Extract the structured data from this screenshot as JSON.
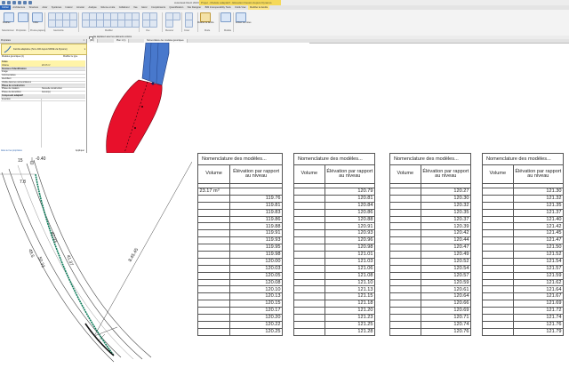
{
  "app": {
    "title": "Autodesk Revit 2023.1",
    "context_tab_title": "Projet - Modèle adaptatif - Elévation Dessin depuis Dynamo"
  },
  "ribbon": {
    "tabs": [
      "Fichier",
      "Architecture",
      "Structure",
      "Acier",
      "Systèmes",
      "Insérer",
      "Annoter",
      "Analyse",
      "Volume et site",
      "Collaborer",
      "Vue",
      "Gérer",
      "Compléments",
      "Quantification",
      "Site Designer",
      "BIM Interoperability Tools",
      "Outils Vrac"
    ],
    "groups": [
      "Sélectionner",
      "Propriétés",
      "Presse-papiers",
      "Géométrie",
      "Modifier",
      "Vue",
      "Mesurer",
      "Créer",
      "Mode",
      "Modèle"
    ],
    "buttons": {
      "modify": "Modifier",
      "paste": "Coller",
      "modify_family": "Modifier la famille",
      "edit_mode": "Activer les cotes",
      "host": "Choisir un nouvel hôte"
    }
  },
  "options_bar": {
    "label": "Ne déplacez avec les éléments voisins"
  },
  "properties": {
    "header": "Propriétés",
    "type_name": "Famille adaptative (Terre 400 depuis MODE via Dynamo)",
    "type_selector": "Modèles génériques (1)",
    "edit_type": "Modifier le type",
    "rows": [
      {
        "k": "Cotes",
        "v": "",
        "sect": true,
        "hl": true
      },
      {
        "k": "Volume",
        "v": "23.17 m³",
        "hl": true
      },
      {
        "k": "Données d'identification",
        "v": "",
        "sect": true
      },
      {
        "k": "Image",
        "v": ""
      },
      {
        "k": "Commentaires",
        "v": ""
      },
      {
        "k": "Identifiant",
        "v": ""
      },
      {
        "k": "Visible dans les nomenclatures",
        "v": ""
      },
      {
        "k": "Phase de construction",
        "v": "",
        "sect": true
      },
      {
        "k": "Phase de création",
        "v": "Nouvelle construction"
      },
      {
        "k": "Phase de démolition",
        "v": "Aucun(e)"
      },
      {
        "k": "Composant adaptatif",
        "v": "",
        "sect": true
      },
      {
        "k": "Inversion",
        "v": ""
      }
    ],
    "help_link": "Aide sur les propriétés",
    "apply": "Appliquer"
  },
  "view_tabs": [
    "{3D}",
    "Plan 1 (1)",
    "Nomenclature des modèles génériques"
  ],
  "plan": {
    "annotations": [
      "-0.40",
      "8.45.45",
      "41.37",
      "42.03",
      "50.33",
      "49.5",
      "7.8",
      "15"
    ]
  },
  "schedules": [
    {
      "title": "Nomenclature des modèles...",
      "col1": "Volume",
      "col2": "Élévation par rapport au niveau",
      "rows": [
        [
          "23.17 m³",
          ""
        ],
        [
          "",
          "119.76"
        ],
        [
          "",
          "119.81"
        ],
        [
          "",
          "119.83"
        ],
        [
          "",
          "119.86"
        ],
        [
          "",
          "119.88"
        ],
        [
          "",
          "119.91"
        ],
        [
          "",
          "119.93"
        ],
        [
          "",
          "119.95"
        ],
        [
          "",
          "119.98"
        ],
        [
          "",
          "120.00"
        ],
        [
          "",
          "120.03"
        ],
        [
          "",
          "120.05"
        ],
        [
          "",
          "120.08"
        ],
        [
          "",
          "120.10"
        ],
        [
          "",
          "120.13"
        ],
        [
          "",
          "120.15"
        ],
        [
          "",
          "120.17"
        ],
        [
          "",
          "120.20"
        ],
        [
          "",
          "120.22"
        ],
        [
          "",
          "120.25"
        ]
      ]
    },
    {
      "title": "Nomenclature des modèles...",
      "col1": "Volume",
      "col2": "Élévation par rapport au niveau",
      "rows": [
        [
          "",
          "120.79"
        ],
        [
          "",
          "120.81"
        ],
        [
          "",
          "120.84"
        ],
        [
          "",
          "120.86"
        ],
        [
          "",
          "120.88"
        ],
        [
          "",
          "120.91"
        ],
        [
          "",
          "120.93"
        ],
        [
          "",
          "120.96"
        ],
        [
          "",
          "120.98"
        ],
        [
          "",
          "121.01"
        ],
        [
          "",
          "121.03"
        ],
        [
          "",
          "121.06"
        ],
        [
          "",
          "121.08"
        ],
        [
          "",
          "121.10"
        ],
        [
          "",
          "121.13"
        ],
        [
          "",
          "121.15"
        ],
        [
          "",
          "121.18"
        ],
        [
          "",
          "121.20"
        ],
        [
          "",
          "121.23"
        ],
        [
          "",
          "121.25"
        ],
        [
          "",
          "121.28"
        ]
      ]
    },
    {
      "title": "Nomenclature des modèles...",
      "col1": "Volume",
      "col2": "Élévation par rapport au niveau",
      "rows": [
        [
          "",
          "120.27"
        ],
        [
          "",
          "120.30"
        ],
        [
          "",
          "120.32"
        ],
        [
          "",
          "120.35"
        ],
        [
          "",
          "120.37"
        ],
        [
          "",
          "120.39"
        ],
        [
          "",
          "120.42"
        ],
        [
          "",
          "120.44"
        ],
        [
          "",
          "120.47"
        ],
        [
          "",
          "120.49"
        ],
        [
          "",
          "120.52"
        ],
        [
          "",
          "120.54"
        ],
        [
          "",
          "120.57"
        ],
        [
          "",
          "120.59"
        ],
        [
          "",
          "120.61"
        ],
        [
          "",
          "120.64"
        ],
        [
          "",
          "120.66"
        ],
        [
          "",
          "120.69"
        ],
        [
          "",
          "120.71"
        ],
        [
          "",
          "120.74"
        ],
        [
          "",
          "120.76"
        ]
      ]
    },
    {
      "title": "Nomenclature des modèles...",
      "col1": "Volume",
      "col2": "Élévation par rapport au niveau",
      "rows": [
        [
          "",
          "121.30"
        ],
        [
          "",
          "121.32"
        ],
        [
          "",
          "121.35"
        ],
        [
          "",
          "121.37"
        ],
        [
          "",
          "121.40"
        ],
        [
          "",
          "121.42"
        ],
        [
          "",
          "121.45"
        ],
        [
          "",
          "121.47"
        ],
        [
          "",
          "121.50"
        ],
        [
          "",
          "121.52"
        ],
        [
          "",
          "121.54"
        ],
        [
          "",
          "121.57"
        ],
        [
          "",
          "121.59"
        ],
        [
          "",
          "121.62"
        ],
        [
          "",
          "121.64"
        ],
        [
          "",
          "121.67"
        ],
        [
          "",
          "121.69"
        ],
        [
          "",
          "121.72"
        ],
        [
          "",
          "121.74"
        ],
        [
          "",
          "121.76"
        ],
        [
          "",
          "121.79"
        ]
      ]
    }
  ]
}
